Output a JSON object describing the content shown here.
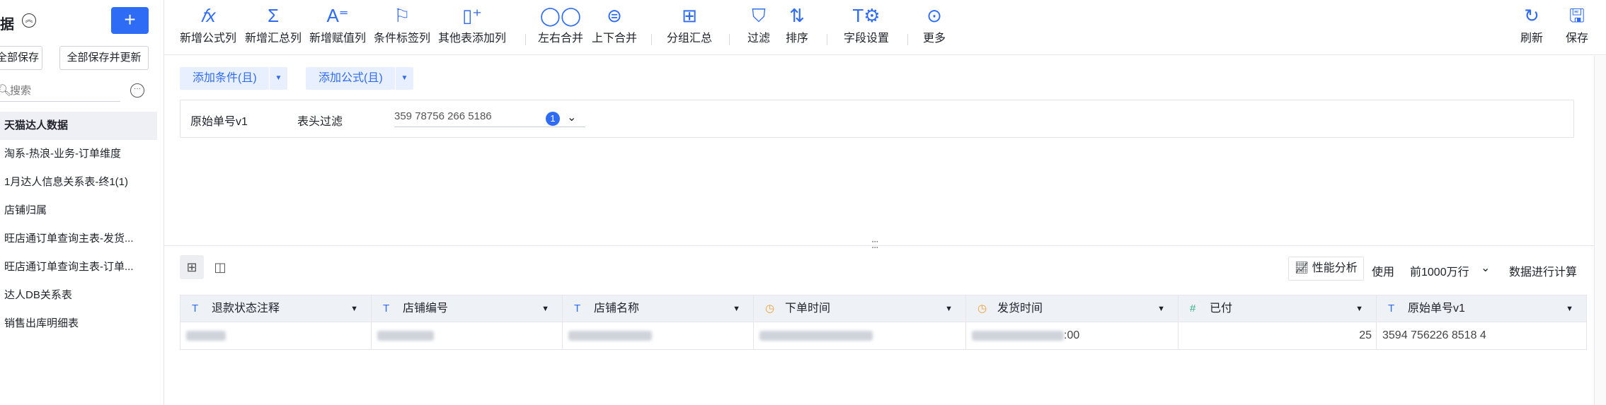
{
  "sidebar": {
    "title": "据",
    "collapse_icon": "collapse-circle-icon",
    "add_label": "+",
    "save_all_label": "全部保存",
    "save_all_update_label": "全部保存并更新",
    "search_placeholder": "搜索",
    "items": [
      {
        "label": "天猫达人数据",
        "active": true
      },
      {
        "label": "淘系-热浪-业务-订单维度"
      },
      {
        "label": "1月达人信息关系表-终1(1)"
      },
      {
        "label": "店铺归属"
      },
      {
        "label": "旺店通订单查询主表-发货..."
      },
      {
        "label": "旺店通订单查询主表-订单..."
      },
      {
        "label": "达人DB关系表"
      },
      {
        "label": "销售出库明细表"
      }
    ]
  },
  "toolbar": {
    "add_formula": "新增公式列",
    "add_summary": "新增汇总列",
    "add_assign": "新增赋值列",
    "add_tag": "条件标签列",
    "add_other": "其他表添加列",
    "merge_lr": "左右合并",
    "merge_tb": "上下合并",
    "group": "分组汇总",
    "filter": "过滤",
    "sort": "排序",
    "fields": "字段设置",
    "more": "更多",
    "refresh": "刷新",
    "save": "保存"
  },
  "conditions": {
    "add_condition": "添加条件(且)",
    "add_formula": "添加公式(且)"
  },
  "filter_row": {
    "field": "原始单号v1",
    "type": "表头过滤",
    "value": "359 78756 266 5186",
    "count": "1"
  },
  "table_controls": {
    "perf_label": "性能分析",
    "use_label": "使用",
    "rows_option": "前1000万行",
    "calc_label": "数据进行计算"
  },
  "columns": [
    {
      "name": "退款状态注释",
      "type_icon": "T"
    },
    {
      "name": "店铺编号",
      "type_icon": "T"
    },
    {
      "name": "店铺名称",
      "type_icon": "T"
    },
    {
      "name": "下单时间",
      "type_icon": "◷"
    },
    {
      "name": "发货时间",
      "type_icon": "◷"
    },
    {
      "name": "已付",
      "type_icon": "#"
    },
    {
      "name": "原始单号v1",
      "type_icon": "T"
    }
  ],
  "row": {
    "paid": "25",
    "order_no": "3594 756226 8518 4",
    "ship_time_tail": ":00"
  },
  "colors": {
    "accent": "#2f6cf6",
    "header_bg": "#eef1f6"
  }
}
